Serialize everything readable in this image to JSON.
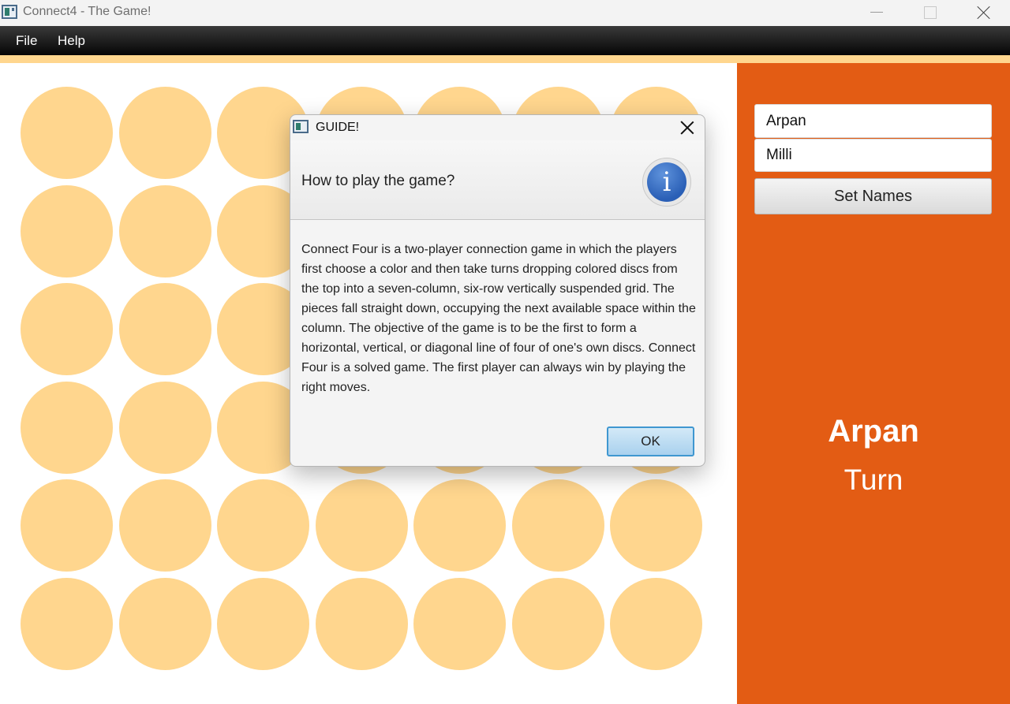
{
  "window": {
    "title": "Connect4 - The Game!",
    "icon": "app-window-icon"
  },
  "menu": {
    "file": "File",
    "help": "Help"
  },
  "board": {
    "columns": 7,
    "rows": 6,
    "disc_color": "#ffd68e"
  },
  "side_panel": {
    "player1_value": "Arpan",
    "player2_value": "Milli",
    "set_names_label": "Set Names",
    "current_player": "Arpan",
    "turn_label": "Turn",
    "background_color": "#e35c14"
  },
  "dialog": {
    "title": "GUIDE!",
    "header": "How to play the game?",
    "icon": "info-icon",
    "body": "Connect Four is a two-player connection game in which the players first choose a color and then take turns dropping colored discs from the top into a seven-column, six-row vertically suspended grid. The pieces fall straight down, occupying the next available space within the column. The objective of the game is to be the first to form a horizontal, vertical, or diagonal line of four of one's own discs. Connect Four is a solved game. The first player can always win by playing the right moves.",
    "ok_label": "OK"
  }
}
